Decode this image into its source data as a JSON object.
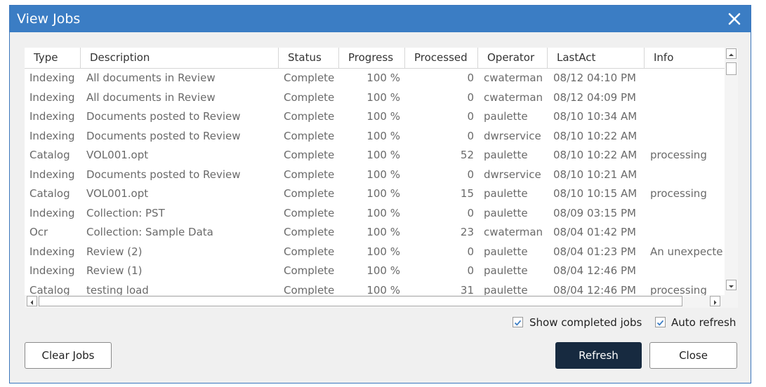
{
  "dialog": {
    "title": "View Jobs"
  },
  "columns": [
    "Type",
    "Description",
    "Status",
    "Progress",
    "Processed",
    "Operator",
    "LastAct",
    "Info"
  ],
  "rows": [
    {
      "type": "Indexing",
      "description": "All documents in Review",
      "status": "Complete",
      "progress": "100 %",
      "processed": "0",
      "operator": "cwaterman",
      "lastact": "08/12 04:10 PM",
      "info": ""
    },
    {
      "type": "Indexing",
      "description": "All documents in Review",
      "status": "Complete",
      "progress": "100 %",
      "processed": "0",
      "operator": "cwaterman",
      "lastact": "08/12 04:09 PM",
      "info": ""
    },
    {
      "type": "Indexing",
      "description": "Documents posted to Review",
      "status": "Complete",
      "progress": "100 %",
      "processed": "0",
      "operator": "paulette",
      "lastact": "08/10 10:34 AM",
      "info": ""
    },
    {
      "type": "Indexing",
      "description": "Documents posted to Review",
      "status": "Complete",
      "progress": "100 %",
      "processed": "0",
      "operator": "dwrservice",
      "lastact": "08/10 10:22 AM",
      "info": ""
    },
    {
      "type": "Catalog",
      "description": "VOL001.opt",
      "status": "Complete",
      "progress": "100 %",
      "processed": "52",
      "operator": "paulette",
      "lastact": "08/10 10:22 AM",
      "info": "processing"
    },
    {
      "type": "Indexing",
      "description": "Documents posted to Review",
      "status": "Complete",
      "progress": "100 %",
      "processed": "0",
      "operator": "dwrservice",
      "lastact": "08/10 10:21 AM",
      "info": ""
    },
    {
      "type": "Catalog",
      "description": "VOL001.opt",
      "status": "Complete",
      "progress": "100 %",
      "processed": "15",
      "operator": "paulette",
      "lastact": "08/10 10:15 AM",
      "info": "processing"
    },
    {
      "type": "Indexing",
      "description": "Collection: PST",
      "status": "Complete",
      "progress": "100 %",
      "processed": "0",
      "operator": "paulette",
      "lastact": "08/09 03:15 PM",
      "info": ""
    },
    {
      "type": "Ocr",
      "description": "Collection: Sample Data",
      "status": "Complete",
      "progress": "100 %",
      "processed": "23",
      "operator": "cwaterman",
      "lastact": "08/04 01:42 PM",
      "info": ""
    },
    {
      "type": "Indexing",
      "description": "Review (2)",
      "status": "Complete",
      "progress": "100 %",
      "processed": "0",
      "operator": "paulette",
      "lastact": "08/04 01:23 PM",
      "info": "An unexpecte"
    },
    {
      "type": "Indexing",
      "description": "Review (1)",
      "status": "Complete",
      "progress": "100 %",
      "processed": "0",
      "operator": "paulette",
      "lastact": "08/04 12:46 PM",
      "info": ""
    },
    {
      "type": "Catalog",
      "description": "testing load",
      "status": "Complete",
      "progress": "100 %",
      "processed": "31",
      "operator": "paulette",
      "lastact": "08/04 12:46 PM",
      "info": "processing"
    }
  ],
  "options": {
    "show_completed": {
      "label": "Show completed jobs",
      "checked": true
    },
    "auto_refresh": {
      "label": "Auto refresh",
      "checked": true
    }
  },
  "buttons": {
    "clear": "Clear Jobs",
    "refresh": "Refresh",
    "close": "Close"
  },
  "colors": {
    "titlebar": "#3b7dc4",
    "primary_button": "#172a40",
    "check": "#3b7dc4"
  }
}
